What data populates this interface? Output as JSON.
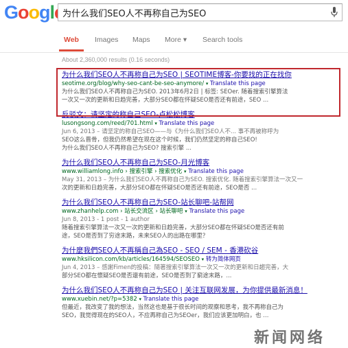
{
  "search": {
    "query": "为什么我们SEO人不再称自己为SEO"
  },
  "nav": {
    "items": [
      "Web",
      "Images",
      "Maps",
      "More ▾",
      "Search tools"
    ]
  },
  "stats": "About 2,360,000 results (0.16 seconds)",
  "results": [
    {
      "title": "为什么我们SEO人不再称自己为SEO | SEOTIME博客-你要找的正在找你",
      "url": "seotime.org/blog/why-seo-cant-be-seo-anymore/",
      "translate": "Translate this page",
      "meta": "",
      "snippet1": "为什么我们SEO人不再称自己为SEO. 2013年6月2日 | 标签: SEOer. 随着搜索引擎算法",
      "snippet2": "一次又一次的更新和日趋完善，大部分SEO都在怀疑SEO是否还有前途，SEO ..."
    },
    {
      "title": "反驳文：请坚定的称自己SEO-卢松松博客",
      "url": "lusongsong.com/reed/701.html",
      "translate": "Translate this page",
      "meta": "Jun 6, 2013 – 请坚定的称自己SEO——与《为什么我们SEO人不... 事不再被称呼为",
      "snippet1": "SEO这么晋骨，但我仍然希望在现在这个时候，我们仍然坚定的称自己SEO!",
      "snippet2": "为什么我们SEO人不再称自己为SEO? 搜索引擎 ..."
    },
    {
      "title": "为什么我们SEO人不再称自己为SEO-月光博客",
      "url": "www.williamlong.info › 搜索引擎 › 搜索优化",
      "translate": "Translate this page",
      "meta": "May 31, 2013 – 为什么我们SEO人不再称自己为SEO. 搜索优化. 随着搜索引擎算法一次又一",
      "snippet1": "次的更新和日趋完善，大部分SEO都在怀疑SEO是否还有前途，SEO是否 ...",
      "snippet2": ""
    },
    {
      "title": "为什么我们SEO人不再称自己为SEO-站长聊吧-站帮网",
      "url": "www.zhanhelp.com › 站长交流区 › 站长聊吧",
      "translate": "Translate this page",
      "meta": "Jun 8, 2013 - 1 post - 1 author",
      "snippet1": "随着搜索引擎算法一次又一次的更新和日趋完善，大部分SEO都在怀疑SEO是否还有前",
      "snippet2": "途，SEO是否到了穷途末路，未来SEO人的出路在哪里？"
    },
    {
      "title": "为什麼我們SEO人不再稱自己為SEO - SEO / SEM - 香港砍谷",
      "url": "www.hksilicon.com/kb/articles/164594/SEOSEO",
      "translate": "转为简体网页",
      "meta": "Jun 4, 2013 – 感謝Fimen的投稿：隨著搜索引擎算法一次又一次的更新和日趨完善，大",
      "snippet1": "部分SEO都在懷疑SEO是否還有前途，SEO是否到了窮途末路，...",
      "snippet2": ""
    },
    {
      "title": "为什么我们SEO人不再称自己为SEO | 关注互联网发展，为你提供最新消息！",
      "url": "www.xuebin.net/?p=5382",
      "translate": "Translate this page",
      "meta": "",
      "snippet1": "但最近，我改变了我的想法，当然这也是基于很长时间的观察和思考，我不再称自己为",
      "snippet2": "SEO，我觉得现在的SEO人，不应再称自己为SEOer，我们应该更加明白，也 ..."
    }
  ],
  "watermark": "新闻网络",
  "colors": {
    "link": "#1a0dab",
    "url": "#006621",
    "active_tab": "#dd4b39",
    "highlight_box": "#c0272d"
  }
}
